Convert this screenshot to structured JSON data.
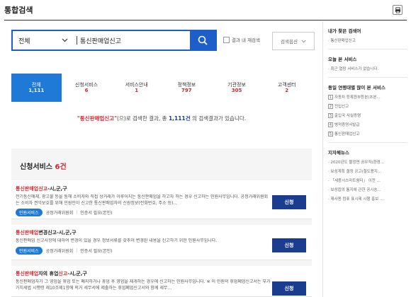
{
  "page": {
    "title": "통합검색"
  },
  "search": {
    "scope": "전체",
    "query": "통신판매업신고",
    "within_results_label": "결과 내 재검색",
    "options_label": "검색옵션"
  },
  "tabs": [
    {
      "label": "전체",
      "count": "1,111",
      "active": true
    },
    {
      "label": "신청서비스",
      "count": "6"
    },
    {
      "label": "서비스안내",
      "count": "1"
    },
    {
      "label": "정책정보",
      "count": "797"
    },
    {
      "label": "기관정보",
      "count": "305"
    },
    {
      "label": "고객센터",
      "count": "2"
    }
  ],
  "summary": {
    "keyword": "\"통신판매업신고\"",
    "text1": "(으)로 검색한 결과, 총 ",
    "total": "1,111건",
    "text2": " 의 검색결과가 있습니다."
  },
  "section": {
    "title": "신청서비스",
    "count": "6건"
  },
  "results": [
    {
      "title_hl": "통신판매업신고",
      "title_rest": "-시,군,구",
      "desc": "전기통신매체, 광고물 등을 통해 소비자와 직접 상거래가 이루어지는 통신판매업을 하고자 하는 경우 신고하는 민원사무입니다. 공정거래위원회는 소비자 권익보호를 위해 민원인이 신고한 통신판매업자의 신원정보(전화번호, 주소 등)...",
      "badge": "민원서비스",
      "org": "공정거래위원회",
      "auth": "인증서 필요(본인)",
      "button": "신청"
    },
    {
      "title_hl": "통신판매업",
      "title_rest": "변경신고-시,군,구",
      "desc": "통신판매업 신고사항에 대하여 변경이 있을 경우 정보서류를 갖추어 변경된 내용을 신고하기 위한 민원사무입니다.",
      "badge": "민원서비스",
      "org": "공정거래위원회",
      "auth": "인증서 필요(본인)",
      "button": "신청"
    },
    {
      "title_pre": "통신판매업",
      "title_mid": "자의 휴업",
      "title_hl": "신고",
      "title_rest": "-시,군,구",
      "desc": "통신판매업자가 그 영업을 휴업 또는 폐지하거나 휴업 후 영업을 재개하는 경우에 신고하는 민원사무입니다. ※ 이 민원의 휴업폐업신고서는 부가가치세법 시행령 제10조제1항에 의거 세무서에 제출하는 휴업폐업신고서와 함께 세무...",
      "button": "신청"
    }
  ],
  "sidebar": {
    "sections": [
      {
        "heading": "내가 찾은 검색어",
        "items": [
          "· 통신판매업신고"
        ]
      },
      {
        "heading": "오늘 본 서비스",
        "items": [
          "· 최근 열람 서비스가 없습니다."
        ]
      },
      {
        "heading": "동일 연령대별 많이 본 서비스",
        "numbered": true,
        "items": [
          "자동차 등록원부등본(초본...",
          "전입신고",
          "출입국 사실증명",
          "병적증명서발급",
          "통신판매업신고"
        ]
      },
      {
        "heading": "지자체뉴스",
        "items": [
          "· 2020년도 물정면 공무직(환경...",
          "· 보성계획 결정 공고(철도용지...",
          "· 「세종시스마트쉼터」 이전 ...",
          "· 보성읍의 통지에 관한 공시송...",
          "· 재사용 컴퓨 표시제 시행 홍보 ..."
        ]
      }
    ]
  },
  "colors": {
    "primary": "#1e5ec8",
    "tab_active": "#1e7ad6",
    "highlight": "#d4232b",
    "button": "#1a3d8f"
  }
}
